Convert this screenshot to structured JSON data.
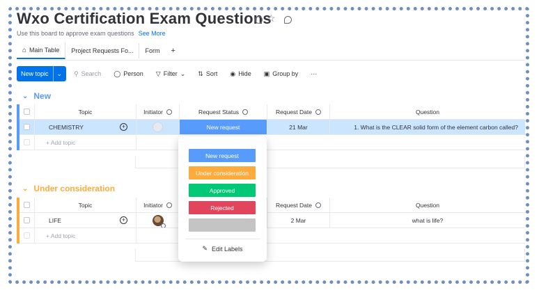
{
  "board": {
    "title": "Wxo Certification Exam Questions",
    "description": "Use this board to approve exam questions",
    "see_more": "See More"
  },
  "tabs": [
    {
      "label": "Main Table",
      "icon": "home-icon"
    },
    {
      "label": "Project Requests Fo..."
    },
    {
      "label": "Form"
    },
    {
      "label": "+"
    }
  ],
  "toolbar": {
    "new_topic": "New topic",
    "search": "Search",
    "person": "Person",
    "filter": "Filter",
    "sort": "Sort",
    "hide": "Hide",
    "group_by": "Group by",
    "more": "···"
  },
  "columns": {
    "topic": "Topic",
    "initiator": "Initiator",
    "request_status": "Request Status",
    "request_date": "Request Date",
    "question": "Question"
  },
  "groups": [
    {
      "name": "New",
      "color": "#579bfc",
      "rows": [
        {
          "topic": "CHEMISTRY",
          "status": "New request",
          "date": "21 Mar",
          "question": "1. What is the CLEAR solid form of the element carbon called?"
        }
      ],
      "add_label": "+ Add topic"
    },
    {
      "name": "Under consideration",
      "color": "#fdab3d",
      "rows": [
        {
          "topic": "LIFE",
          "status": "",
          "date": "2 Mar",
          "question": "what is life?"
        }
      ],
      "add_label": "+ Add topic"
    }
  ],
  "status_dropdown": {
    "options": [
      {
        "label": "New request",
        "color": "#579bfc"
      },
      {
        "label": "Under consideration",
        "color": "#fdab3d"
      },
      {
        "label": "Approved",
        "color": "#00c875"
      },
      {
        "label": "Rejected",
        "color": "#e2445c"
      },
      {
        "label": "",
        "color": "#c4c4c4"
      }
    ],
    "edit_labels": "Edit Labels"
  }
}
